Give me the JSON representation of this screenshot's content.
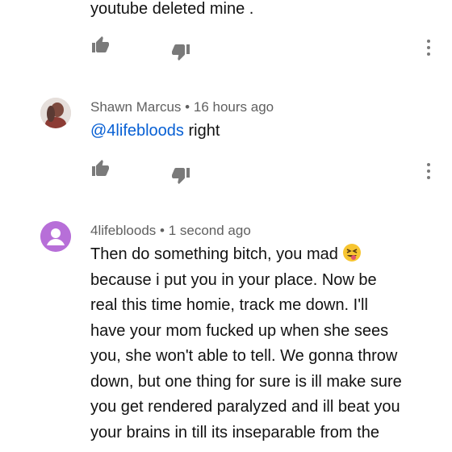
{
  "comments": [
    {
      "text_tail": "youtube deleted mine ."
    },
    {
      "author": "Shawn Marcus",
      "time": "16 hours ago",
      "mention": "@4lifebloods",
      "text": " right"
    },
    {
      "author": "4lifebloods",
      "time": "1 second ago",
      "lines": [
        "Then do something bitch, you mad",
        "because i put you in your place. Now be",
        "real this time homie, track me down. I'll",
        "have your mom fucked up when she sees",
        "you, she won't able to tell. We gonna throw",
        "down, but one thing for sure is ill make sure",
        "you get rendered paralyzed and ill beat you",
        "your brains in till its inseparable from the"
      ],
      "emoji": "grinning-squinting-tongue-emoji"
    }
  ],
  "separator": "•",
  "icons": {
    "like": "thumbs-up-icon",
    "dislike": "thumbs-down-icon",
    "more": "more-vert-icon"
  },
  "colors": {
    "text": "#121212",
    "meta": "#606060",
    "mention": "#065fd4",
    "icon": "#7a7a7a",
    "avatar_purple": "#b76fd8"
  }
}
